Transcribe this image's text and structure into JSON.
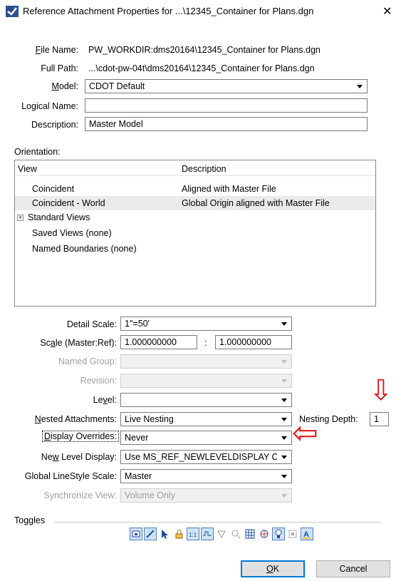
{
  "window": {
    "title": "Reference Attachment Properties for ...\\12345_Container for Plans.dgn",
    "close_glyph": "✕",
    "app_icon": "microstation-icon"
  },
  "fields": {
    "file_name_label": "File Name:",
    "file_name_value": "PW_WORKDIR:dms20164\\12345_Container for Plans.dgn",
    "full_path_label": "Full Path:",
    "full_path_value": "...\\cdot-pw-04t\\dms20164\\12345_Container for Plans.dgn",
    "model_label": "Model:",
    "model_value": "CDOT Default",
    "logical_name_label": "Logical Name:",
    "logical_name_value": "",
    "description_label": "Description:",
    "description_value": "Master Model"
  },
  "orientation": {
    "section_label": "Orientation:",
    "col_view": "View",
    "col_description": "Description",
    "rows": [
      {
        "view": "Coincident",
        "description": "Aligned with Master File"
      },
      {
        "view": "Coincident - World",
        "description": "Global Origin aligned with Master File"
      },
      {
        "view": "Standard Views",
        "description": ""
      },
      {
        "view": "Saved Views (none)",
        "description": ""
      },
      {
        "view": "Named Boundaries (none)",
        "description": ""
      }
    ],
    "selected_row": "Coincident - World",
    "expander_glyph": "+"
  },
  "settings": {
    "detail_scale_label": "Detail Scale:",
    "detail_scale_value": "1\"=50'",
    "scale_label": "Scale (Master:Ref):",
    "scale_master": "1.000000000",
    "scale_separator": ":",
    "scale_ref": "1.000000000",
    "named_group_label": "Named Group:",
    "revision_label": "Revision:",
    "level_label": "Level:",
    "nested_label": "Nested Attachments:",
    "nested_value": "Live Nesting",
    "nesting_depth_label": "Nesting Depth:",
    "nesting_depth_value": "1",
    "display_overrides_label": "Display Overrides:",
    "display_overrides_value": "Never",
    "new_level_display_label": "New Level Display:",
    "new_level_display_value": "Use MS_REF_NEWLEVELDISPLAY Co",
    "global_linestyle_label": "Global LineStyle Scale:",
    "global_linestyle_value": "Master",
    "sync_view_label": "Synchronize View:",
    "sync_view_value": "Volume Only"
  },
  "toggles": {
    "section_label": "Toggles",
    "icons": [
      "display-toggle-icon",
      "snap-toggle-icon",
      "locate-toggle-icon",
      "lock-toggle-icon",
      "scale-toggle-icon",
      "linestyle-toggle-icon",
      "ignore-toggle-icon",
      "treat-as-element-icon",
      "grid-toggle-icon",
      "raster-toggle-icon",
      "lights-toggle-icon",
      "clip-toggle-icon",
      "text-toggle-icon"
    ]
  },
  "buttons": {
    "ok": "OK",
    "cancel": "Cancel"
  },
  "annotations": {
    "arrow_color": "#e01b1b",
    "down_arrow": "⇩",
    "left_arrow": "⇦"
  }
}
